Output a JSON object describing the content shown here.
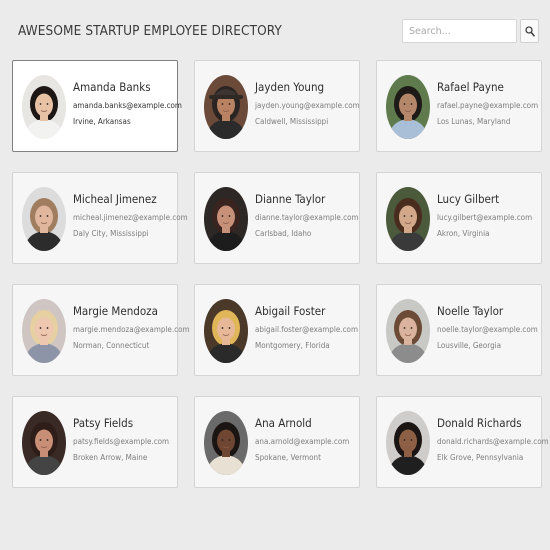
{
  "header": {
    "title": "AWESOME STARTUP EMPLOYEE DIRECTORY",
    "search_placeholder": "Search...",
    "search_icon": "search-icon"
  },
  "employees": [
    {
      "name": "Amanda Banks",
      "email": "amanda.banks@example.com",
      "location": "Irvine, Arkansas",
      "selected": true,
      "bg": "#e8e6e2",
      "skin": "#e7c2a5",
      "hair": "#1c1614",
      "shirt": "#f2f2f0"
    },
    {
      "name": "Jayden Young",
      "email": "jayden.young@example.com",
      "location": "Caldwell, Mississippi",
      "bg": "#6b4a3a",
      "skin": "#b98363",
      "hair": "#2a2522",
      "shirt": "#2b2b2b",
      "hat": true
    },
    {
      "name": "Rafael Payne",
      "email": "rafael.payne@example.com",
      "location": "Los Lunas, Maryland",
      "bg": "#5f7a4d",
      "skin": "#b5876a",
      "hair": "#1e1a18",
      "shirt": "#a9bfd8"
    },
    {
      "name": "Micheal Jimenez",
      "email": "micheal.jimenez@example.com",
      "location": "Daly City, Mississippi",
      "bg": "#dcdcdc",
      "skin": "#e0b79d",
      "hair": "#a07d5f",
      "shirt": "#2c2c2c"
    },
    {
      "name": "Dianne Taylor",
      "email": "dianne.taylor@example.com",
      "location": "Carlsbad, Idaho",
      "bg": "#2d2725",
      "skin": "#c79078",
      "hair": "#3a2420",
      "shirt": "#1d1d1d"
    },
    {
      "name": "Lucy Gilbert",
      "email": "lucy.gilbert@example.com",
      "location": "Akron, Virginia",
      "bg": "#4c5a3c",
      "skin": "#d2a88b",
      "hair": "#4a2c1e",
      "shirt": "#3a3a3a"
    },
    {
      "name": "Margie Mendoza",
      "email": "margie.mendoza@example.com",
      "location": "Norman, Connecticut",
      "bg": "#cfc6c4",
      "skin": "#eec7b0",
      "hair": "#e6cfa0",
      "shirt": "#8e94a8"
    },
    {
      "name": "Abigail Foster",
      "email": "abigail.foster@example.com",
      "location": "Montgomery, Florida",
      "bg": "#4a3828",
      "skin": "#e6b898",
      "hair": "#e0b658",
      "shirt": "#2a2a2a"
    },
    {
      "name": "Noelle Taylor",
      "email": "noelle.taylor@example.com",
      "location": "Lousville, Georgia",
      "bg": "#c8c8c4",
      "skin": "#d9b39d",
      "hair": "#6b4a36",
      "shirt": "#8c8c8c"
    },
    {
      "name": "Patsy Fields",
      "email": "patsy.fields@example.com",
      "location": "Broken Arrow, Maine",
      "bg": "#3a2a26",
      "skin": "#c98e76",
      "hair": "#2e1d18",
      "shirt": "#444"
    },
    {
      "name": "Ana Arnold",
      "email": "ana.arnold@example.com",
      "location": "Spokane, Vermont",
      "bg": "#6a6a6a",
      "skin": "#6e4632",
      "hair": "#1a1412",
      "shirt": "#e8e0d2"
    },
    {
      "name": "Donald Richards",
      "email": "donald.richards@example.com",
      "location": "Elk Grove, Pennsylvania",
      "bg": "#cfcdcb",
      "skin": "#8d5f45",
      "hair": "#1a1513",
      "shirt": "#1f1f1f"
    }
  ]
}
